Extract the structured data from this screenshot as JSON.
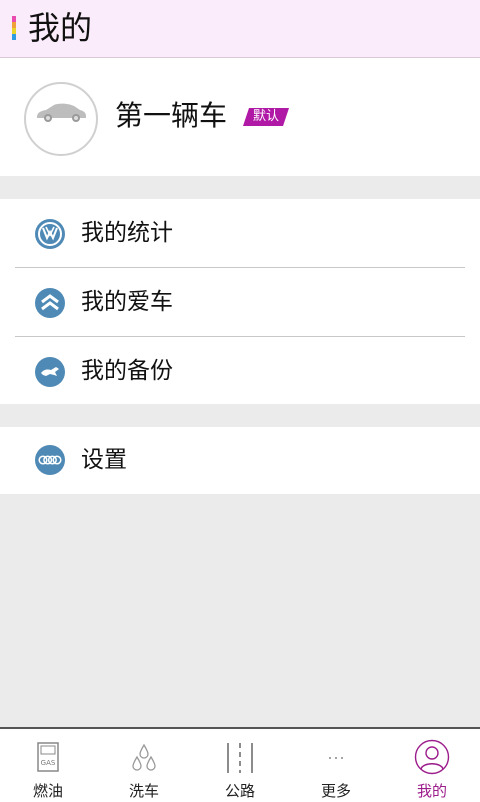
{
  "header": {
    "title": "我的"
  },
  "car": {
    "name": "第一辆车",
    "badge": "默认"
  },
  "menu": {
    "group1": [
      {
        "label": "我的统计",
        "icon": "vw-logo-icon"
      },
      {
        "label": "我的爱车",
        "icon": "citroen-logo-icon"
      },
      {
        "label": "我的备份",
        "icon": "mustang-logo-icon"
      }
    ],
    "group2": [
      {
        "label": "设置",
        "icon": "audi-rings-icon"
      }
    ]
  },
  "tabs": [
    {
      "label": "燃油",
      "icon": "gas-pump-icon"
    },
    {
      "label": "洗车",
      "icon": "water-drops-icon"
    },
    {
      "label": "公路",
      "icon": "road-icon"
    },
    {
      "label": "更多",
      "icon": "more-dots-icon"
    },
    {
      "label": "我的",
      "icon": "user-icon",
      "active": true
    }
  ],
  "colors": {
    "accent": "#9c1d8c",
    "badge": "#b019a5",
    "icon_blue": "#4e8ab5",
    "header_bg": "#fbecfb"
  }
}
